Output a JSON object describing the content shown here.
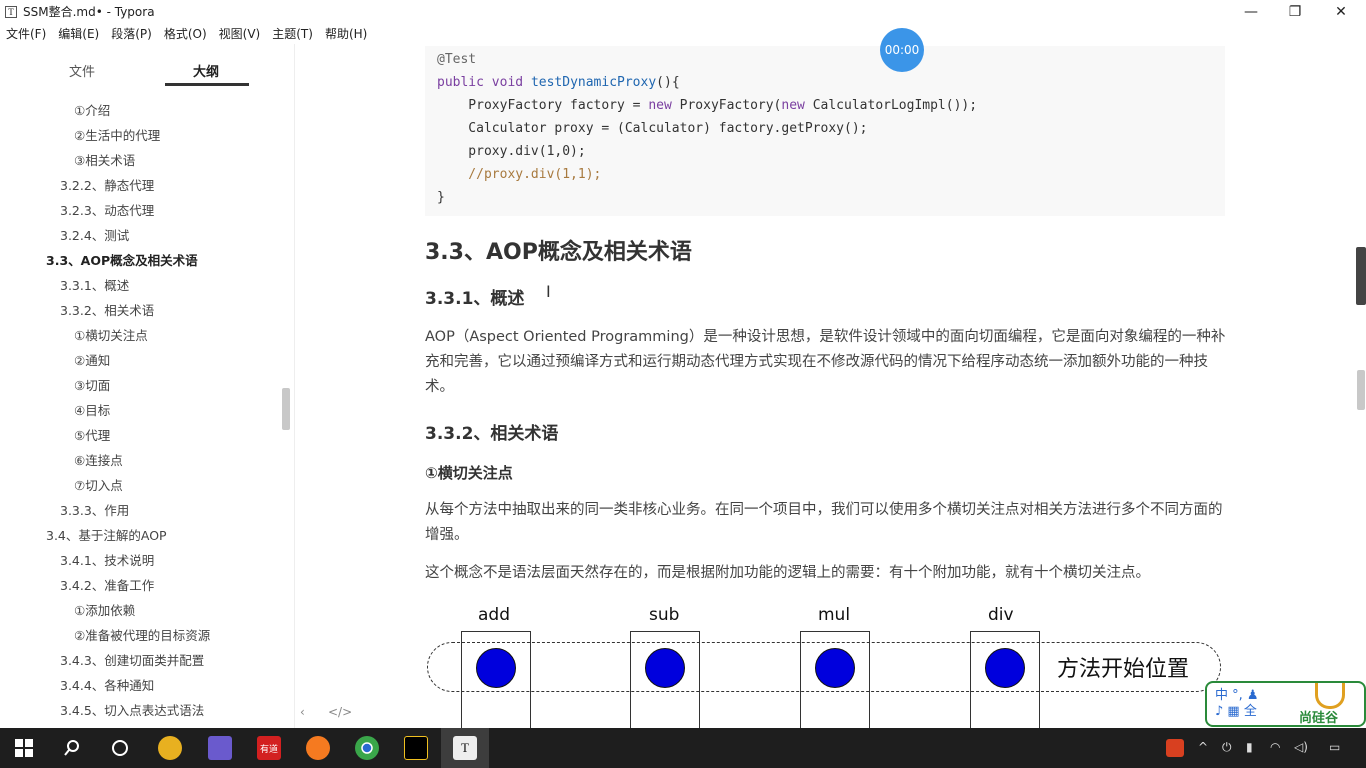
{
  "window": {
    "title": "SSM整合.md• - Typora",
    "app_icon_letter": "T",
    "minimize": "—",
    "restore": "❐",
    "close": "✕"
  },
  "menu": [
    "文件(F)",
    "编辑(E)",
    "段落(P)",
    "格式(O)",
    "视图(V)",
    "主题(T)",
    "帮助(H)"
  ],
  "sidebar": {
    "tabs": [
      {
        "label": "文件"
      },
      {
        "label": "大纲"
      }
    ],
    "outline": [
      {
        "label": "①介绍"
      },
      {
        "label": "②生活中的代理"
      },
      {
        "label": "③相关术语"
      },
      {
        "label": "3.2.2、静态代理"
      },
      {
        "label": "3.2.3、动态代理"
      },
      {
        "label": "3.2.4、测试"
      },
      {
        "label": "3.3、AOP概念及相关术语"
      },
      {
        "label": "3.3.1、概述"
      },
      {
        "label": "3.3.2、相关术语"
      },
      {
        "label": "①横切关注点"
      },
      {
        "label": "②通知"
      },
      {
        "label": "③切面"
      },
      {
        "label": "④目标"
      },
      {
        "label": "⑤代理"
      },
      {
        "label": "⑥连接点"
      },
      {
        "label": "⑦切入点"
      },
      {
        "label": "3.3.3、作用"
      },
      {
        "label": "3.4、基于注解的AOP"
      },
      {
        "label": "3.4.1、技术说明"
      },
      {
        "label": "3.4.2、准备工作"
      },
      {
        "label": "①添加依赖"
      },
      {
        "label": "②准备被代理的目标资源"
      },
      {
        "label": "3.4.3、创建切面类并配置"
      },
      {
        "label": "3.4.4、各种通知"
      },
      {
        "label": "3.4.5、切入点表达式语法"
      }
    ],
    "footer_left": "‹",
    "footer_right": "</>"
  },
  "code": {
    "l1": "@Test",
    "l2_kw1": "public",
    "l2_kw2": "void",
    "l2_fn": "testDynamicProxy",
    "l2_rest": "(){",
    "l3": "    ProxyFactory factory = ",
    "l3_kw": "new",
    "l3_mid": " ProxyFactory(",
    "l3_kw2": "new",
    "l3_end": " CalculatorLogImpl());",
    "l4": "    Calculator proxy = (Calculator) factory.getProxy();",
    "l5": "    proxy.div(1,0);",
    "l6": "    //proxy.div(1,1);",
    "l7": "}"
  },
  "content": {
    "h2": "3.3、AOP概念及相关术语",
    "h3_overview": "3.3.1、概述",
    "p_overview": "AOP（Aspect Oriented Programming）是一种设计思想，是软件设计领域中的面向切面编程，它是面向对象编程的一种补充和完善，它以通过预编译方式和运行期动态代理方式实现在不修改源代码的情况下给程序动态统一添加额外功能的一种技术。",
    "h3_terms": "3.3.2、相关术语",
    "h4_crosscut": "①横切关注点",
    "p_crosscut1": "从每个方法中抽取出来的同一类非核心业务。在同一个项目中，我们可以使用多个横切关注点对相关方法进行多个不同方面的增强。",
    "p_crosscut2": "这个概念不是语法层面天然存在的，而是根据附加功能的逻辑上的需要：有十个附加功能，就有十个横切关注点。"
  },
  "diagram": {
    "methods": [
      "add",
      "sub",
      "mul",
      "div"
    ],
    "pill_label": "方法开始位置",
    "dot_color": "#0000dd"
  },
  "timer": "00:00",
  "widget": {
    "ime_line1": "中 °, ♟",
    "ime_line2": "♪ ▦ 全",
    "brand": "尚硅谷"
  },
  "taskbar": {
    "youdao": "有道",
    "tray_chevron": "^"
  }
}
